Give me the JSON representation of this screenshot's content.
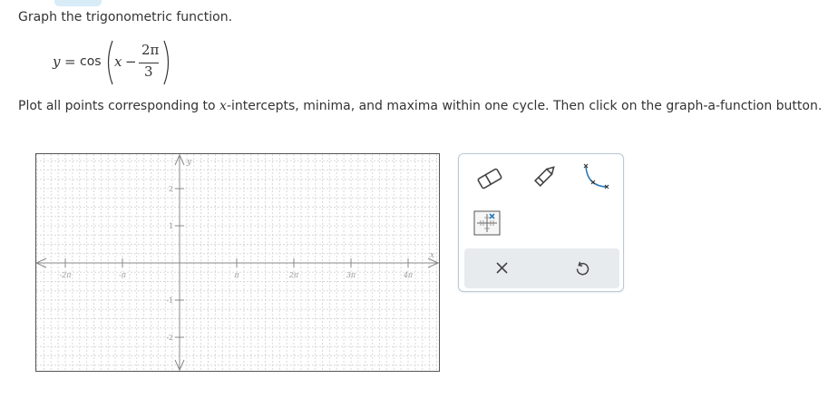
{
  "question": {
    "instruction": "Graph the trigonometric function.",
    "equation": {
      "lhs": "y",
      "equals": "=",
      "func": "cos",
      "var": "x",
      "minus": "−",
      "numerator": "2π",
      "denominator": "3"
    },
    "plot_instruction": {
      "part1": "Plot all points corresponding to ",
      "var": "x",
      "part2": "-intercepts, minima, and maxima within one cycle. Then click on the graph-a-function button."
    }
  },
  "graph": {
    "x_axis_label": "x",
    "y_axis_label": "y",
    "x_ticks": [
      {
        "value": -2,
        "label": "-2π"
      },
      {
        "value": -1,
        "label": "-π"
      },
      {
        "value": 1,
        "label": "π"
      },
      {
        "value": 2,
        "label": "2π"
      },
      {
        "value": 3,
        "label": "3π"
      },
      {
        "value": 4,
        "label": "4π"
      }
    ],
    "y_ticks": [
      {
        "value": 2,
        "label": "2"
      },
      {
        "value": 1,
        "label": "1"
      },
      {
        "value": -1,
        "label": "-1"
      },
      {
        "value": -2,
        "label": "-2"
      }
    ],
    "x_range_pi_units": [
      -2.5,
      4.5
    ],
    "y_range": [
      -2.9,
      2.9
    ],
    "grid": true,
    "colors": {
      "grid": "#d9d9d9",
      "axis": "#888888",
      "labels": "#9a9a9a",
      "border": "#555555"
    }
  },
  "toolbox": {
    "tools": [
      "eraser-icon",
      "pencil-icon",
      "curve-icon",
      "grid-point-icon"
    ],
    "actions": [
      "close-icon",
      "undo-icon"
    ],
    "colors": {
      "icon": "#444444",
      "accent": "#2b7bb9",
      "actions_bg": "#e8ebee"
    }
  }
}
